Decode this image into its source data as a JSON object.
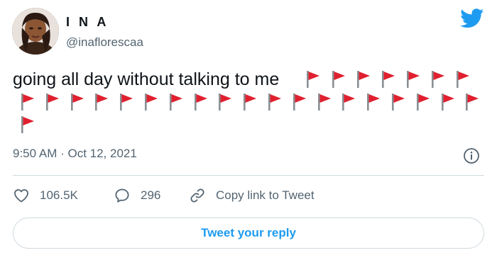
{
  "author": {
    "name": "I N A",
    "handle": "@inaflorescaa",
    "avatar_icon": "profile-photo"
  },
  "brand": {
    "icon": "twitter-bird-icon",
    "color": "#1d9bf0"
  },
  "tweet": {
    "text": "going all day without talking to me",
    "emoji": "red-flag-icon",
    "emoji_color": "#e0202f",
    "emoji_count": 27,
    "timestamp": "9:50 AM · Oct 12, 2021"
  },
  "actions": {
    "likes": "106.5K",
    "replies": "296",
    "copy_link": "Copy link to Tweet"
  },
  "reply_button": "Tweet your reply"
}
